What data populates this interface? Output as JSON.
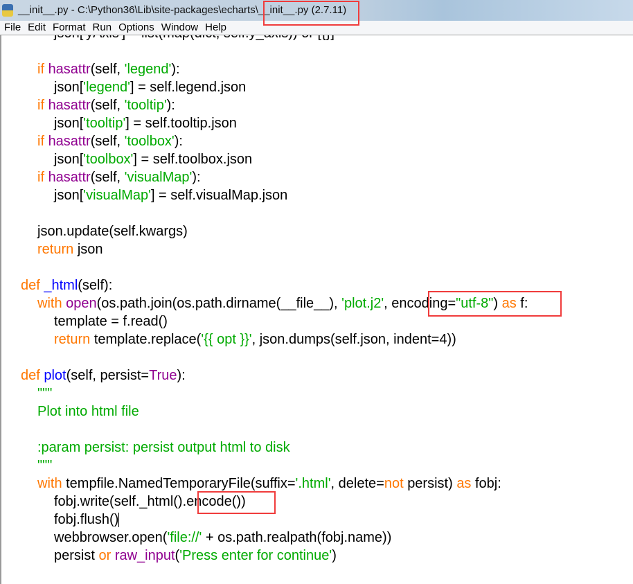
{
  "window": {
    "title": "__init__.py - C:\\Python36\\Lib\\site-packages\\echarts\\__init__.py (2.7.11)",
    "app_icon": "python-idle-icon"
  },
  "menu": [
    "File",
    "Edit",
    "Format",
    "Run",
    "Options",
    "Window",
    "Help"
  ],
  "colors": {
    "keyword": "#ff7700",
    "builtin": "#900090",
    "string": "#00aa00",
    "definition": "#0000ff",
    "highlight_box": "#f03c3c"
  },
  "code": [
    {
      "indent": 2,
      "tokens": [
        [
          "",
          "json['yAxis'] = list(map(dict, self.y_axis)) or [{}]"
        ]
      ]
    },
    {
      "indent": 0,
      "tokens": []
    },
    {
      "indent": 1,
      "tokens": [
        [
          "kw",
          "if "
        ],
        [
          "bi",
          "hasattr"
        ],
        [
          "",
          "(self, "
        ],
        [
          "str",
          "'legend'"
        ],
        [
          "",
          "):"
        ]
      ]
    },
    {
      "indent": 2,
      "tokens": [
        [
          "",
          "json["
        ],
        [
          "str",
          "'legend'"
        ],
        [
          "",
          "] = self.legend.json"
        ]
      ]
    },
    {
      "indent": 1,
      "tokens": [
        [
          "kw",
          "if "
        ],
        [
          "bi",
          "hasattr"
        ],
        [
          "",
          "(self, "
        ],
        [
          "str",
          "'tooltip'"
        ],
        [
          "",
          "):"
        ]
      ]
    },
    {
      "indent": 2,
      "tokens": [
        [
          "",
          "json["
        ],
        [
          "str",
          "'tooltip'"
        ],
        [
          "",
          "] = self.tooltip.json"
        ]
      ]
    },
    {
      "indent": 1,
      "tokens": [
        [
          "kw",
          "if "
        ],
        [
          "bi",
          "hasattr"
        ],
        [
          "",
          "(self, "
        ],
        [
          "str",
          "'toolbox'"
        ],
        [
          "",
          "):"
        ]
      ]
    },
    {
      "indent": 2,
      "tokens": [
        [
          "",
          "json["
        ],
        [
          "str",
          "'toolbox'"
        ],
        [
          "",
          "] = self.toolbox.json"
        ]
      ]
    },
    {
      "indent": 1,
      "tokens": [
        [
          "kw",
          "if "
        ],
        [
          "bi",
          "hasattr"
        ],
        [
          "",
          "(self, "
        ],
        [
          "str",
          "'visualMap'"
        ],
        [
          "",
          "):"
        ]
      ]
    },
    {
      "indent": 2,
      "tokens": [
        [
          "",
          "json["
        ],
        [
          "str",
          "'visualMap'"
        ],
        [
          "",
          "] = self.visualMap.json"
        ]
      ]
    },
    {
      "indent": 0,
      "tokens": []
    },
    {
      "indent": 1,
      "tokens": [
        [
          "",
          "json.update(self.kwargs)"
        ]
      ]
    },
    {
      "indent": 1,
      "tokens": [
        [
          "kw",
          "return "
        ],
        [
          "",
          "json"
        ]
      ]
    },
    {
      "indent": 0,
      "tokens": []
    },
    {
      "indent": 0,
      "tokens": [
        [
          "kw",
          "def "
        ],
        [
          "def",
          "_html"
        ],
        [
          "",
          "(self):"
        ]
      ]
    },
    {
      "indent": 1,
      "tokens": [
        [
          "kw",
          "with "
        ],
        [
          "bi",
          "open"
        ],
        [
          "",
          "(os.path.join(os.path.dirname(__file__), "
        ],
        [
          "str",
          "'plot.j2'"
        ],
        [
          "",
          ", encoding="
        ],
        [
          "str",
          "\"utf-8\""
        ],
        [
          "",
          ") "
        ],
        [
          "kw",
          "as "
        ],
        [
          "",
          "f:"
        ]
      ]
    },
    {
      "indent": 2,
      "tokens": [
        [
          "",
          "template = f.read()"
        ]
      ]
    },
    {
      "indent": 2,
      "tokens": [
        [
          "kw",
          "return "
        ],
        [
          "",
          "template.replace("
        ],
        [
          "str",
          "'{{ opt }}'"
        ],
        [
          "",
          ", json.dumps(self.json, indent=4))"
        ]
      ]
    },
    {
      "indent": 0,
      "tokens": []
    },
    {
      "indent": 0,
      "tokens": [
        [
          "kw",
          "def "
        ],
        [
          "def",
          "plot"
        ],
        [
          "",
          "(self, persist="
        ],
        [
          "bi",
          "True"
        ],
        [
          "",
          "):"
        ]
      ]
    },
    {
      "indent": 1,
      "tokens": [
        [
          "str",
          "\"\"\""
        ]
      ]
    },
    {
      "indent": 1,
      "tokens": [
        [
          "str",
          "Plot into html file"
        ]
      ]
    },
    {
      "indent": 0,
      "tokens": []
    },
    {
      "indent": 1,
      "tokens": [
        [
          "str",
          ":param persist: persist output html to disk"
        ]
      ]
    },
    {
      "indent": 1,
      "tokens": [
        [
          "str",
          "\"\"\""
        ]
      ]
    },
    {
      "indent": 1,
      "tokens": [
        [
          "kw",
          "with "
        ],
        [
          "",
          "tempfile.NamedTemporaryFile(suffix="
        ],
        [
          "str",
          "'.html'"
        ],
        [
          "",
          ", delete="
        ],
        [
          "kw",
          "not "
        ],
        [
          "",
          "persist) "
        ],
        [
          "kw",
          "as "
        ],
        [
          "",
          "fobj:"
        ]
      ]
    },
    {
      "indent": 2,
      "tokens": [
        [
          "",
          "fobj.write(self._html().encode())"
        ]
      ]
    },
    {
      "indent": 2,
      "tokens": [
        [
          "",
          "fobj.flush()"
        ]
      ],
      "caret": true
    },
    {
      "indent": 2,
      "tokens": [
        [
          "",
          "webbrowser.open("
        ],
        [
          "str",
          "'file://'"
        ],
        [
          "",
          " + os.path.realpath(fobj.name))"
        ]
      ]
    },
    {
      "indent": 2,
      "tokens": [
        [
          "",
          "persist "
        ],
        [
          "kw",
          "or "
        ],
        [
          "bi",
          "raw_input"
        ],
        [
          "",
          "("
        ],
        [
          "str",
          "'Press enter for continue'"
        ],
        [
          "",
          ")"
        ]
      ]
    }
  ]
}
